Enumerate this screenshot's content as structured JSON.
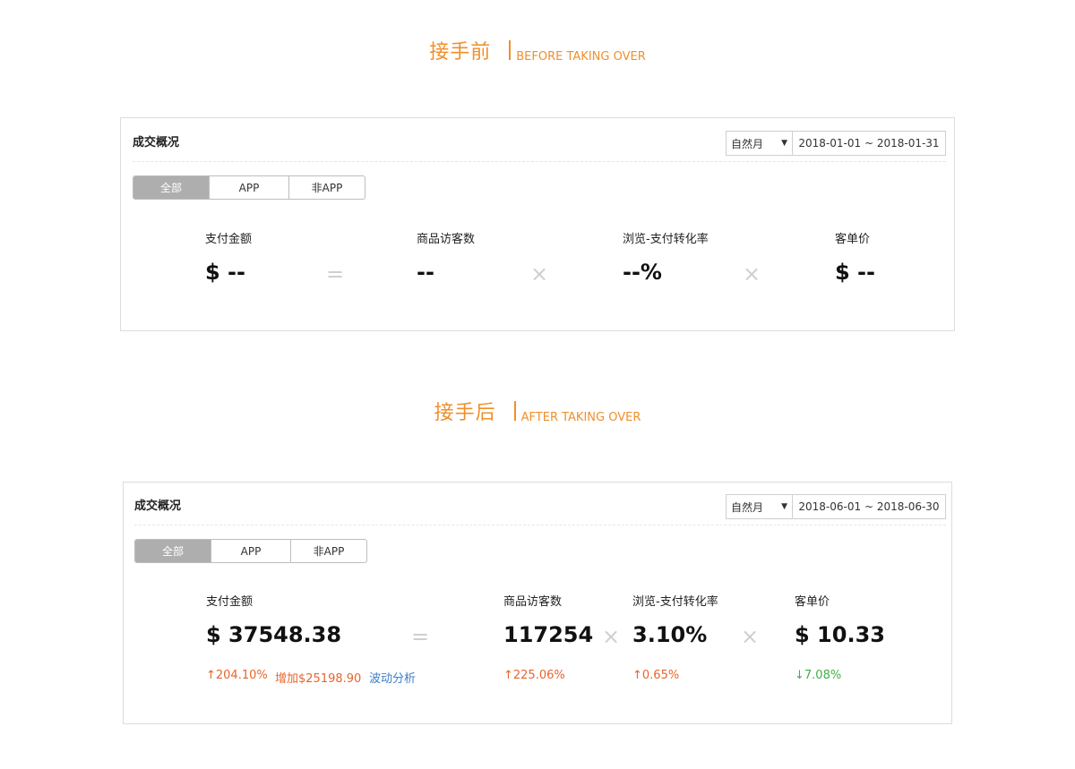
{
  "colors": {
    "accent": "#ef8f2c",
    "up": "#e8642c",
    "down": "#3fae49",
    "link": "#3c7dc4"
  },
  "before": {
    "heading_cn": "接手前",
    "heading_en": "BEFORE TAKING OVER",
    "panel_title": "成交概况",
    "period": "自然月",
    "date_range": "2018-01-01 ~ 2018-01-31",
    "tabs": [
      "全部",
      "APP",
      "非APP"
    ],
    "metrics": [
      {
        "label": "支付金额",
        "value": "$ --"
      },
      {
        "label": "商品访客数",
        "value": "--"
      },
      {
        "label": "浏览-支付转化率",
        "value": "--%"
      },
      {
        "label": "客单价",
        "value": "$ --"
      }
    ],
    "operators": [
      "=",
      "×",
      "×"
    ]
  },
  "after": {
    "heading_cn": "接手后",
    "heading_en": "AFTER TAKING OVER",
    "panel_title": "成交概况",
    "period": "自然月",
    "date_range": "2018-06-01 ~ 2018-06-30",
    "tabs": [
      "全部",
      "APP",
      "非APP"
    ],
    "metrics": [
      {
        "label": "支付金额",
        "value": "$ 37548.38",
        "change": "↑204.10%",
        "increase": "增加$25198.90",
        "analysis_link": "波动分析"
      },
      {
        "label": "商品访客数",
        "value": "117254",
        "change": "↑225.06%"
      },
      {
        "label": "浏览-支付转化率",
        "value": "3.10%",
        "change": "↑0.65%"
      },
      {
        "label": "客单价",
        "value": "$ 10.33",
        "change": "↓7.08%"
      }
    ],
    "operators": [
      "=",
      "×",
      "×"
    ]
  }
}
